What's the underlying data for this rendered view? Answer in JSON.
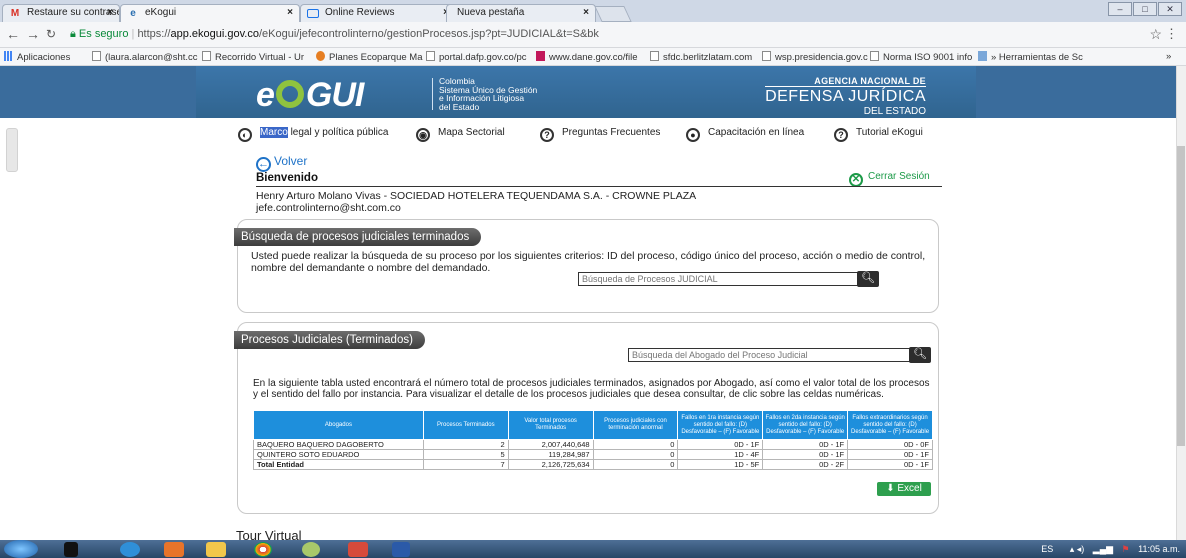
{
  "browser": {
    "tabs": [
      {
        "label": "Restaure su contraseña p",
        "icon": "gmail-icon",
        "active": false
      },
      {
        "label": "eKogui",
        "icon": "ekogui-icon",
        "active": true
      },
      {
        "label": "Online Reviews",
        "icon": "monitor-icon",
        "active": false
      },
      {
        "label": "Nueva pestaña",
        "icon": "",
        "active": false
      }
    ],
    "url_secure": "Es seguro",
    "url_scheme": "https://",
    "url_host": "app.ekogui.gov.co",
    "url_path": "/eKogui/jefecontrolinterno/gestionProcesos.jsp?pt=JUDICIAL&t=S&bk",
    "bookmarks": [
      "Aplicaciones",
      "(laura.alarcon@sht.cc",
      "Recorrido Virtual - Ur",
      "Planes Ecoparque Ma",
      "portal.dafp.gov.co/pc",
      "www.dane.gov.co/file",
      "sfdc.berlitzlatam.com",
      "wsp.presidencia.gov.c",
      "Norma ISO 9001 info",
      "» Herramientas de Sc"
    ],
    "bookmarks_more": "»"
  },
  "header": {
    "logo_text_1": "e",
    "logo_text_2": "GUI",
    "logo_sub": [
      "Colombia",
      "Sistema Único de Gestión",
      "e Información Litigiosa",
      "del Estado"
    ],
    "agency_line1": "AGENCIA NACIONAL DE",
    "agency_line2": "DEFENSA JURÍDICA",
    "agency_line3": "DEL ESTADO"
  },
  "menu": {
    "marco_highlight": "Marco",
    "marco_rest": " legal y política pública",
    "mapa": "Mapa Sectorial",
    "preguntas": "Preguntas Frecuentes",
    "capacitacion": "Capacitación en línea",
    "tutorial": "Tutorial eKogui"
  },
  "welcome": {
    "volver": "Volver",
    "title": "Bienvenido",
    "user_line": "Henry Arturo Molano Vivas - SOCIEDAD HOTELERA TEQUENDAMA S.A. - CROWNE PLAZA",
    "email": "jefe.controlinterno@sht.com.co",
    "logout": "Cerrar Sesión"
  },
  "panel1": {
    "title": "Búsqueda de procesos judiciales terminados",
    "text": "Usted puede realizar la búsqueda de su proceso por los siguientes criterios: ID del proceso, código único del proceso, acción o medio de control, nombre del demandante o nombre del demandado.",
    "search_placeholder": "Búsqueda de Procesos JUDICIAL"
  },
  "panel2": {
    "title": "Procesos Judiciales (Terminados)",
    "search_placeholder": "Búsqueda del Abogado del Proceso Judicial",
    "text": "En la siguiente tabla usted encontrará el número total de procesos judiciales terminados, asignados por Abogado, así como el valor total de los procesos y el sentido del fallo por instancia. Para visualizar el detalle de los procesos judiciales que desea consultar, de clic sobre las celdas numéricas.",
    "table": {
      "headers": [
        "Abogados",
        "Procesos Terminados",
        "Valor total procesos Terminados",
        "Procesos judiciales con terminación anormal",
        "Fallos en 1ra instancia según sentido del fallo: (D) Desfavorable – (F) Favorable",
        "Fallos en 2da instancia según sentido del fallo: (D) Desfavorable – (F) Favorable",
        "Fallos extraordinarios según sentido del fallo: (D) Desfavorable – (F) Favorable"
      ],
      "rows": [
        [
          "BAQUERO BAQUERO DAGOBERTO",
          "2",
          "2,007,440,648",
          "0",
          "0D - 1F",
          "0D - 1F",
          "0D - 0F"
        ],
        [
          "QUINTERO SOTO EDUARDO",
          "5",
          "119,284,987",
          "0",
          "1D - 4F",
          "0D - 1F",
          "0D - 1F"
        ]
      ],
      "total": [
        "Total Entidad",
        "7",
        "2,126,725,634",
        "0",
        "1D - 5F",
        "0D - 2F",
        "0D - 1F"
      ]
    },
    "excel_label": "Excel"
  },
  "tour_label": "Tour Virtual",
  "taskbar": {
    "lang": "ES",
    "time": "11:05 a.m."
  },
  "colors": {
    "banner": "#3a6c9c",
    "table_header": "#1e8fdc",
    "excel": "#2e9f4e",
    "logout": "#1c9a48",
    "link": "#1f73c8"
  }
}
